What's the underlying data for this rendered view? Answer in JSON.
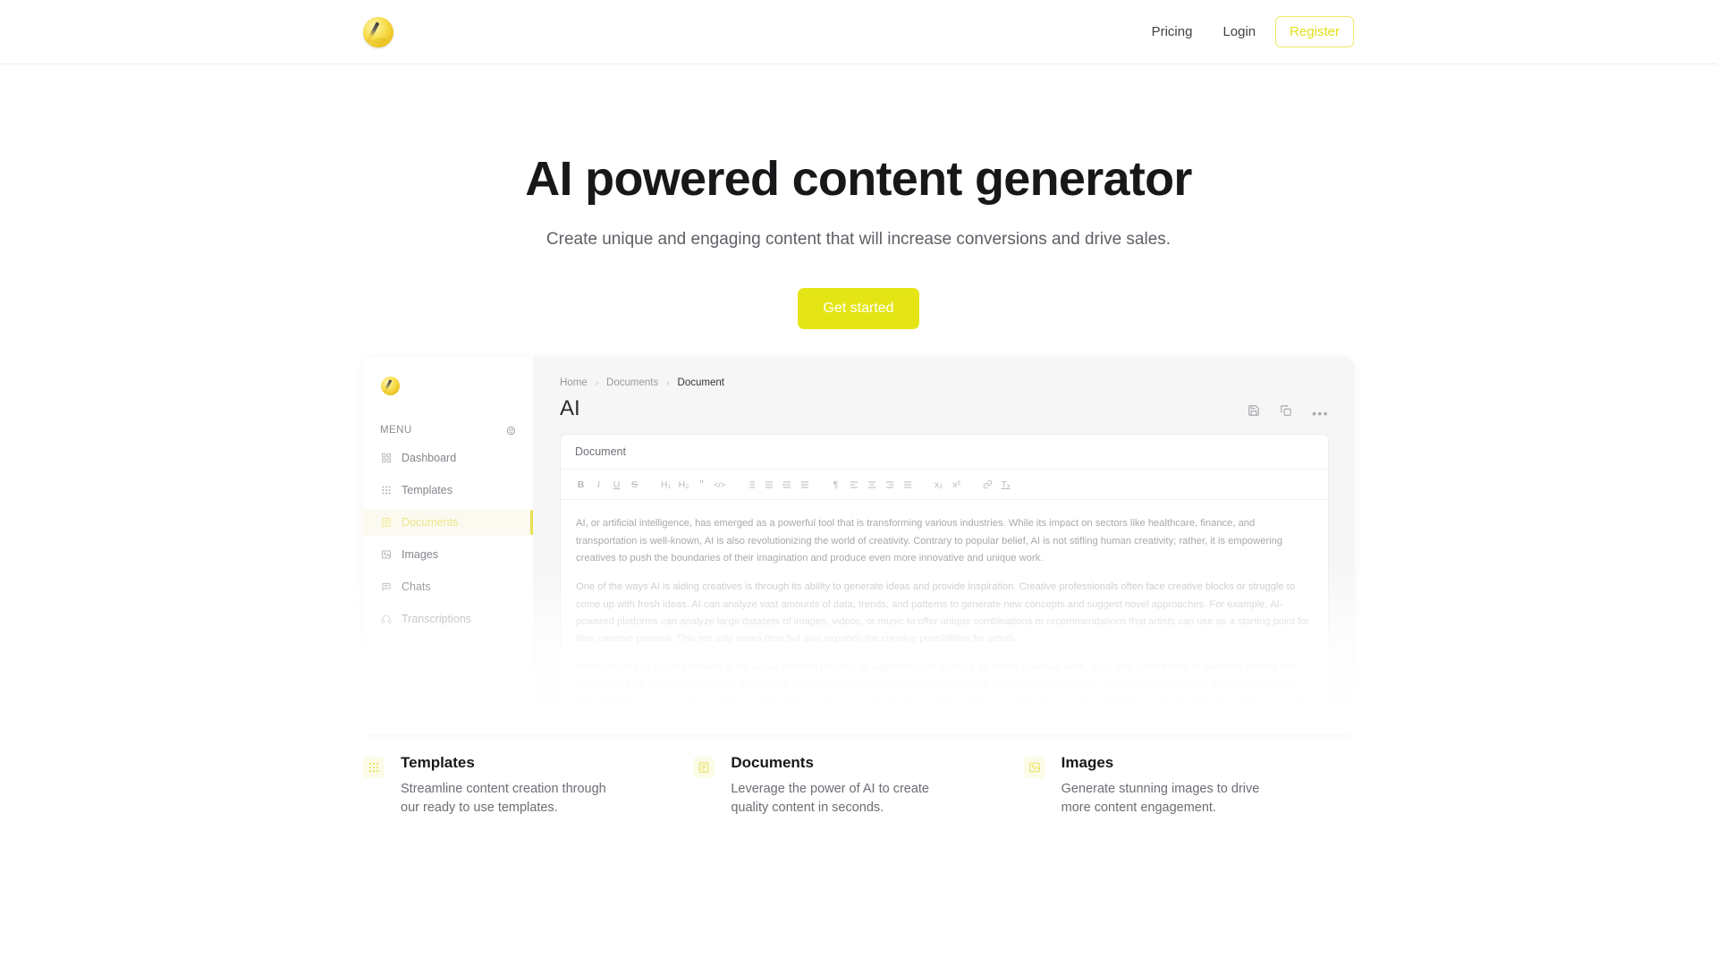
{
  "brand": {
    "logo_icon": "quill-badge-logo"
  },
  "nav": {
    "links": [
      {
        "label": "Pricing",
        "name": "nav-link-pricing"
      },
      {
        "label": "Login",
        "name": "nav-link-login"
      }
    ],
    "register_label": "Register",
    "accent_color": "#e3e01a"
  },
  "hero": {
    "title": "AI powered content generator",
    "subtitle": "Create unique and engaging content that will increase conversions and drive sales.",
    "cta_label": "Get started",
    "cta_color": "#e5e516"
  },
  "preview": {
    "sidebar": {
      "menu_label": "MENU",
      "theme_icon": "theme-toggle-icon",
      "items": [
        {
          "label": "Dashboard",
          "icon": "grid-2x2-icon",
          "active": false
        },
        {
          "label": "Templates",
          "icon": "grid-3x3-dots-icon",
          "active": false
        },
        {
          "label": "Documents",
          "icon": "document-lines-icon",
          "active": true
        },
        {
          "label": "Images",
          "icon": "image-icon",
          "active": false
        },
        {
          "label": "Chats",
          "icon": "chat-bubble-icon",
          "active": false
        },
        {
          "label": "Transcriptions",
          "icon": "headphones-icon",
          "active": false
        }
      ],
      "active_color": "#e8e150"
    },
    "breadcrumb": [
      "Home",
      "Documents",
      "Document"
    ],
    "doc_title": "AI",
    "doc_actions": [
      {
        "name": "save-icon",
        "label": "save"
      },
      {
        "name": "copy-icon",
        "label": "copy"
      },
      {
        "name": "more-options-icon",
        "label": "•••"
      }
    ],
    "editor": {
      "title_value": "Document",
      "toolbar": [
        {
          "label": "B",
          "name": "bold-button"
        },
        {
          "label": "I",
          "name": "italic-button"
        },
        {
          "label": "U",
          "name": "underline-button"
        },
        {
          "label": "S",
          "name": "strikethrough-button"
        },
        {
          "label": "H₁",
          "name": "heading-1-button"
        },
        {
          "label": "H₂",
          "name": "heading-2-button"
        },
        {
          "label": "”",
          "name": "blockquote-button"
        },
        {
          "label": "</>",
          "name": "code-block-button"
        },
        {
          "label": "≡",
          "name": "ordered-list-button"
        },
        {
          "label": "≡",
          "name": "bullet-list-button"
        },
        {
          "label": "≡",
          "name": "outdent-button"
        },
        {
          "label": "≡",
          "name": "indent-button"
        },
        {
          "label": "¶",
          "name": "text-direction-button"
        },
        {
          "label": "≡",
          "name": "align-left-button"
        },
        {
          "label": "≡",
          "name": "align-center-button"
        },
        {
          "label": "≡",
          "name": "align-right-button"
        },
        {
          "label": "≡",
          "name": "align-justify-button"
        },
        {
          "label": "x₂",
          "name": "subscript-button"
        },
        {
          "label": "x²",
          "name": "superscript-button"
        },
        {
          "label": "🔗",
          "name": "link-button"
        },
        {
          "label": "Tₓ",
          "name": "clear-format-button"
        }
      ],
      "paragraphs": [
        "AI, or artificial intelligence, has emerged as a powerful tool that is transforming various industries. While its impact on sectors like healthcare, finance, and transportation is well-known, AI is also revolutionizing the world of creativity. Contrary to popular belief, AI is not stifling human creativity; rather, it is empowering creatives to push the boundaries of their imagination and produce even more innovative and unique work.",
        "One of the ways AI is aiding creatives is through its ability to generate ideas and provide inspiration. Creative professionals often face creative blocks or struggle to come up with fresh ideas. AI can analyze vast amounts of data, trends, and patterns to generate new concepts and suggest novel approaches. For example, AI-powered platforms can analyze large datasets of images, videos, or music to offer unique combinations or recommendations that artists can use as a starting point for their creative process. This not only saves time but also expands the creative possibilities for artists.",
        "Moreover, AI can assist creatives in the actual creation process. AI algorithms can analyze an artist's previous work, style, and preferences to generate content that aligns with their vision. For instance, AI can help a songwriter compose melodies or lyrics that resonate with their style, or an artist create visual designs that reflect their aesthetic. By automating certain aspects of the creative process, AI allows artists to focus on higher-level conceptualization and experimentation, enhancing their overall output."
      ]
    }
  },
  "features": [
    {
      "icon": "grid-3x3-dots-icon",
      "title": "Templates",
      "description": "Streamline content creation through our ready to use templates."
    },
    {
      "icon": "document-lines-icon",
      "title": "Documents",
      "description": "Leverage the power of AI to create quality content in seconds."
    },
    {
      "icon": "image-icon",
      "title": "Images",
      "description": "Generate stunning images to drive more content engagement."
    }
  ]
}
